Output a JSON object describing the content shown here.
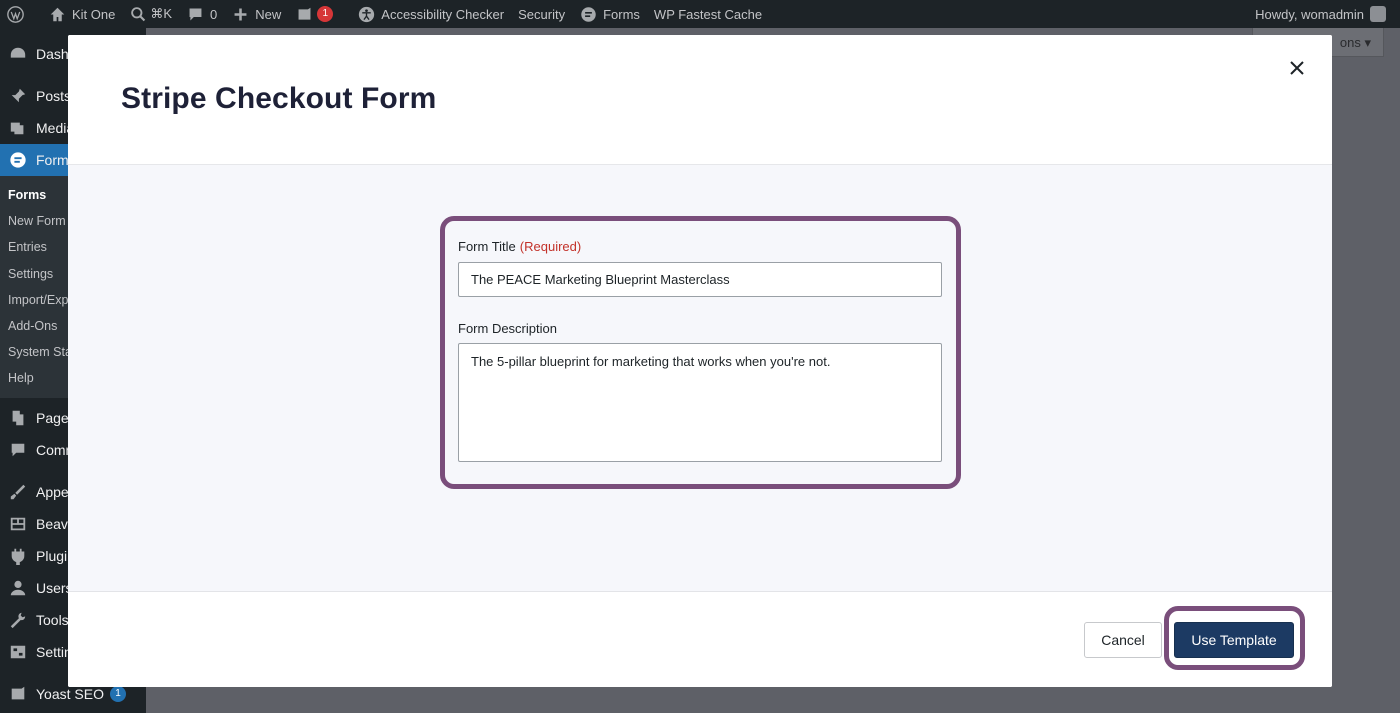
{
  "admin_bar": {
    "site_name": "Kit One",
    "shortcut": "⌘K",
    "comments_count": "0",
    "new_label": "New",
    "yoast_count": "1",
    "accessibility_label": "Accessibility Checker",
    "security_label": "Security",
    "forms_label": "Forms",
    "cache_label": "WP Fastest Cache",
    "greeting": "Howdy, womadmin"
  },
  "sidebar": {
    "items": [
      {
        "label": "Dashb",
        "icon": "dashboard-icon"
      },
      {
        "label": "Posts",
        "icon": "pin-icon"
      },
      {
        "label": "Media",
        "icon": "media-icon"
      },
      {
        "label": "Forms",
        "icon": "forms-icon"
      }
    ],
    "submenu": [
      "Forms",
      "New Form",
      "Entries",
      "Settings",
      "Import/Exp",
      "Add-Ons",
      "System Sta",
      "Help"
    ],
    "items_after": [
      {
        "label": "Pages",
        "icon": "pages-icon"
      },
      {
        "label": "Comm",
        "icon": "comments-icon"
      },
      {
        "label": "Appea",
        "icon": "appearance-icon"
      },
      {
        "label": "Beave",
        "icon": "beaver-icon"
      },
      {
        "label": "Plugin",
        "icon": "plugins-icon"
      },
      {
        "label": "Users",
        "icon": "users-icon"
      },
      {
        "label": "Tools",
        "icon": "tools-icon"
      },
      {
        "label": "Settin",
        "icon": "settings-icon"
      },
      {
        "label": "Yoast SEO",
        "icon": "yoast-icon"
      }
    ],
    "yoast_badge": "1"
  },
  "background": {
    "screen_options_label": "ons ▾"
  },
  "modal": {
    "title": "Stripe Checkout Form",
    "form": {
      "title_label": "Form Title",
      "required_label": "(Required)",
      "title_value": "The PEACE Marketing Blueprint Masterclass",
      "description_label": "Form Description",
      "description_value": "The 5-pillar blueprint for marketing that works when you're not."
    },
    "cancel_label": "Cancel",
    "use_template_label": "Use Template"
  },
  "colors": {
    "highlight": "#7a4e7b",
    "primary_button": "#1c3a63",
    "required": "#c3322a"
  }
}
